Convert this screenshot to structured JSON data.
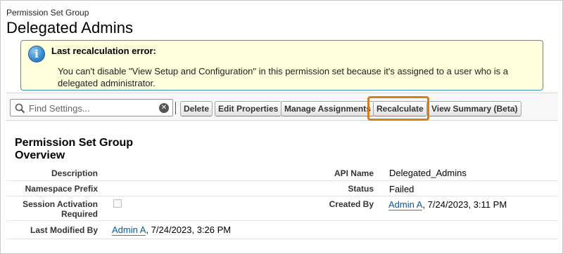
{
  "header": {
    "object_type": "Permission Set Group",
    "title": "Delegated Admins"
  },
  "alert": {
    "icon": "info-icon",
    "title": "Last recalculation error:",
    "message": "You can't disable \"View Setup and Configuration\" in this permission set because it's assigned to a user who is a delegated administrator."
  },
  "toolbar": {
    "search_placeholder": "Find Settings...",
    "buttons": {
      "delete": "Delete",
      "edit_properties": "Edit Properties",
      "manage_assignments": "Manage Assignments",
      "recalculate": "Recalculate",
      "view_summary": "View Summary (Beta)"
    },
    "highlighted_button": "Recalculate"
  },
  "overview": {
    "title": "Permission Set Group Overview",
    "fields": {
      "description": {
        "label": "Description",
        "value": ""
      },
      "api_name": {
        "label": "API Name",
        "value": "Delegated_Admins"
      },
      "namespace_prefix": {
        "label": "Namespace Prefix",
        "value": ""
      },
      "status": {
        "label": "Status",
        "value": "Failed"
      },
      "session_activation": {
        "label": "Session Activation Required",
        "checked": false
      },
      "created_by": {
        "label": "Created By",
        "user": "Admin A",
        "date": ", 7/24/2023, 3:11 PM"
      },
      "last_modified_by": {
        "label": "Last Modified By",
        "user": "Admin A",
        "date": ", 7/24/2023, 3:26 PM"
      }
    }
  },
  "colors": {
    "alert_background": "#ffffdc",
    "alert_border": "#3399cc",
    "highlight_border": "#d27f1d",
    "link": "#015ba7"
  }
}
